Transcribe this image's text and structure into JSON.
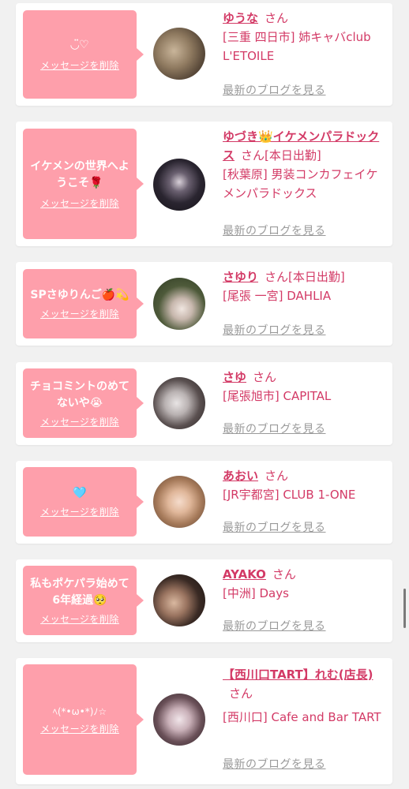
{
  "delete_label": "メッセージを削除",
  "blog_label": "最新のブログを見る",
  "honorific": "さん",
  "items": [
    {
      "message": "◡̈♡",
      "name": "ゆうな",
      "status": "",
      "shop": "[三重 四日市] 姉キャバclub L'ETOILE"
    },
    {
      "message": "イケメンの世界へようこそ🌹",
      "name": "ゆづき👑イケメンパラドックス",
      "status": "[本日出勤]",
      "shop": "[秋葉原] 男装コンカフェイケメンパラドックス"
    },
    {
      "message": "SPさゆりんご🍎💫",
      "name": "さゆり",
      "status": "[本日出勤]",
      "shop": "[尾張 一宮] DAHLIA"
    },
    {
      "message": "チョコミントのめてないや😭",
      "name": "さゆ",
      "status": "",
      "shop": "[尾張旭市] CAPITAL"
    },
    {
      "message": "🩵",
      "name": "あおい",
      "status": "",
      "shop": "[JR宇都宮] CLUB 1-ONE"
    },
    {
      "message": "私もポケパラ始めて6年経過🥺",
      "name": "AYAKO",
      "status": "",
      "shop": "[中洲] Days"
    },
    {
      "message": "ﾍ(*•ω•*)ﾉ☆",
      "name": "【西川口TART】れむ(店長)",
      "status": "",
      "shop": "[西川口] Cafe and Bar TART"
    }
  ],
  "colors": {
    "bubble": "#fe9fab",
    "accent": "#d33a66",
    "muted": "#9a9a9a",
    "background": "#f1f1f1"
  }
}
